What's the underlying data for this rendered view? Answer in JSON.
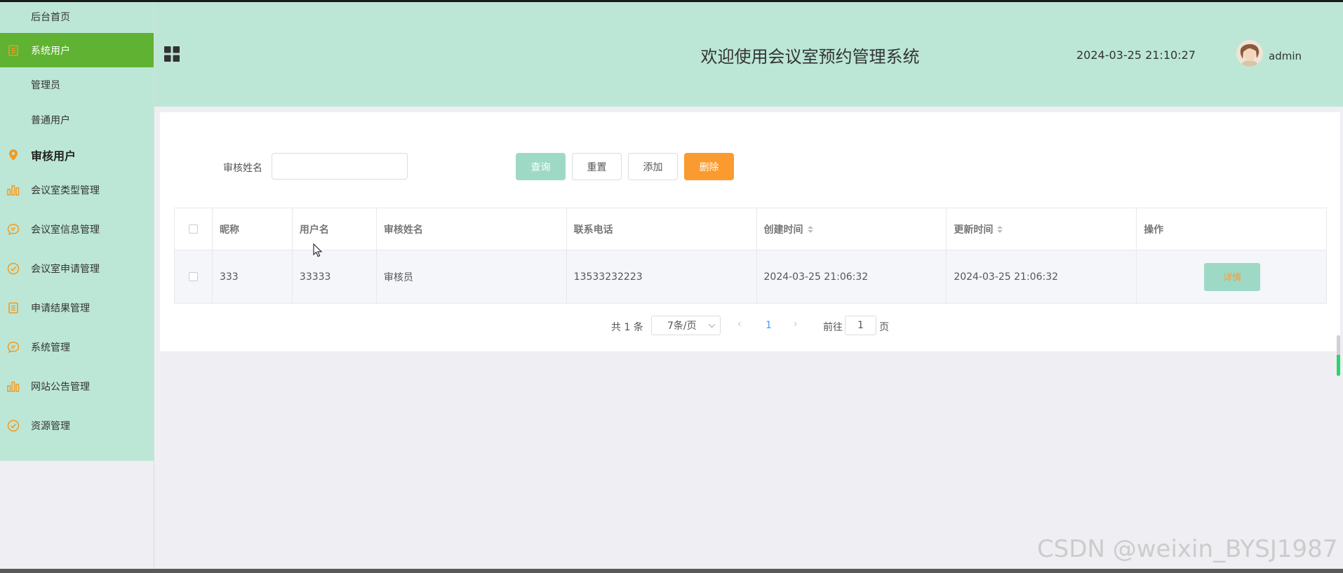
{
  "sidebar": {
    "items": [
      {
        "label": "后台首页",
        "icon": "none",
        "state": "normal"
      },
      {
        "label": "系统用户",
        "icon": "document-icon",
        "state": "active"
      },
      {
        "label": "管理员",
        "icon": "none",
        "state": "sub"
      },
      {
        "label": "普通用户",
        "icon": "none",
        "state": "sub"
      },
      {
        "label": "审核用户",
        "icon": "location-pin-icon",
        "state": "bold"
      },
      {
        "label": "会议室类型管理",
        "icon": "bar-chart-icon",
        "state": "normal"
      },
      {
        "label": "会议室信息管理",
        "icon": "chat-bubble-icon",
        "state": "normal"
      },
      {
        "label": "会议室申请管理",
        "icon": "check-circle-icon",
        "state": "normal"
      },
      {
        "label": "申请结果管理",
        "icon": "document-icon",
        "state": "normal"
      },
      {
        "label": "系统管理",
        "icon": "chat-bubble-icon",
        "state": "normal"
      },
      {
        "label": "网站公告管理",
        "icon": "bar-chart-icon",
        "state": "normal"
      },
      {
        "label": "资源管理",
        "icon": "check-circle-icon",
        "state": "normal"
      }
    ]
  },
  "header": {
    "title": "欢迎使用会议室预约管理系统",
    "datetime": "2024-03-25 21:10:27",
    "username": "admin"
  },
  "search": {
    "label": "审核姓名",
    "value": "",
    "placeholder": ""
  },
  "toolbar": {
    "query_label": "查询",
    "reset_label": "重置",
    "add_label": "添加",
    "delete_label": "删除"
  },
  "table": {
    "headers": [
      "昵称",
      "用户名",
      "审核姓名",
      "联系电话",
      "创建时间",
      "更新时间",
      "操作"
    ],
    "rows": [
      {
        "nickname": "333",
        "username": "33333",
        "reviewer_name": "审核员",
        "phone": "13533232223",
        "created": "2024-03-25 21:06:32",
        "updated": "2024-03-25 21:06:32",
        "action_label": "详情"
      }
    ]
  },
  "pagination": {
    "total_text": "共 1 条",
    "page_size": "7条/页",
    "current_page": "1",
    "goto_label": "前往",
    "goto_value": "1",
    "page_suffix": "页"
  },
  "watermark": "CSDN @weixin_BYSJ1987",
  "colors": {
    "sidebar_bg": "#bce7d7",
    "active_item": "#5fb232",
    "icon_orange": "#f39a1e",
    "query_button": "#9ed9c6",
    "delete_button": "#fb9a2e",
    "page_link": "#409eff"
  }
}
